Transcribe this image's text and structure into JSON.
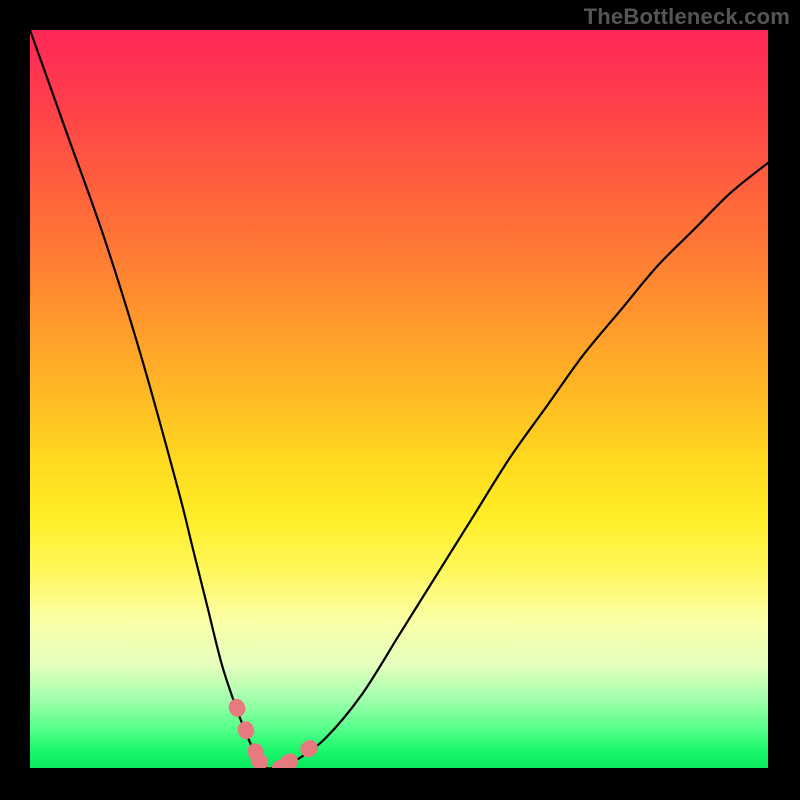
{
  "watermark": "TheBottleneck.com",
  "chart_data": {
    "type": "line",
    "title": "",
    "xlabel": "",
    "ylabel": "",
    "xlim": [
      0,
      100
    ],
    "ylim": [
      0,
      100
    ],
    "grid": false,
    "legend": false,
    "series": [
      {
        "name": "bottleneck-curve",
        "x": [
          0,
          5,
          10,
          15,
          20,
          22,
          24,
          26,
          28,
          30,
          31,
          32,
          33,
          34,
          36,
          40,
          45,
          50,
          55,
          60,
          65,
          70,
          75,
          80,
          85,
          90,
          95,
          100
        ],
        "values": [
          100,
          86,
          72,
          56,
          38,
          30,
          22,
          14,
          8,
          3,
          1,
          0,
          0,
          0,
          1,
          4,
          10,
          18,
          26,
          34,
          42,
          49,
          56,
          62,
          68,
          73,
          78,
          82
        ]
      }
    ],
    "annotations": {
      "optimal_x_range": [
        28,
        37
      ],
      "band_colors_top_to_bottom": [
        "#ff2757",
        "#ffbb24",
        "#fff75a",
        "#14f56a"
      ]
    }
  }
}
